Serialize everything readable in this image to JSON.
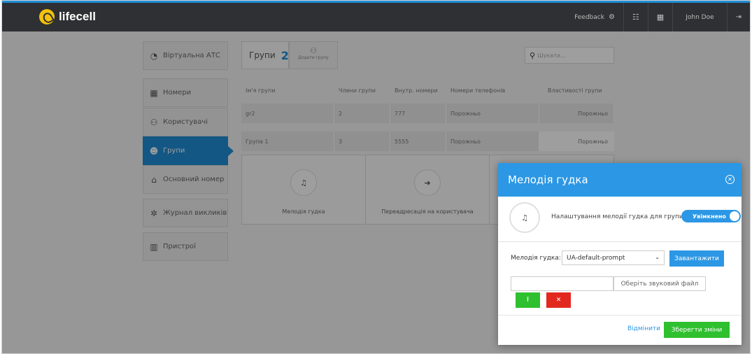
{
  "header": {
    "brand": "lifecell",
    "feedback_label": "Feedback",
    "user_name": "John Doe"
  },
  "sidebar": {
    "items": [
      {
        "label": "Віртуальна АТС",
        "icon": "gauge-icon"
      },
      {
        "label": "Номери",
        "icon": "grid-icon"
      },
      {
        "label": "Користувачі",
        "icon": "users-icon"
      },
      {
        "label": "Групи",
        "icon": "group-icon",
        "active": true
      },
      {
        "label": "Основний номер",
        "icon": "home-icon"
      },
      {
        "label": "Журнал викликів",
        "icon": "call-log-icon"
      },
      {
        "label": "Пристрої",
        "icon": "device-icon"
      }
    ]
  },
  "groups": {
    "title": "Групи",
    "count": "2",
    "add_label": "Додати групу",
    "search_placeholder": "Шукати..."
  },
  "table": {
    "columns": [
      "Ім'я групи",
      "Члени групи",
      "Внутр. номери",
      "Номери телефонів",
      "Властивості групи"
    ],
    "rows": [
      [
        "gr2",
        "2",
        "777",
        "Порожньо",
        "Порожньо"
      ],
      [
        "Група 1",
        "3",
        "5555",
        "Порожньо",
        "Порожньо"
      ]
    ]
  },
  "actions": [
    {
      "label": "Мелодія гудка",
      "icon": "music-note-icon"
    },
    {
      "label": "Переадресація на користувача",
      "icon": "arrow-right-icon"
    }
  ],
  "modal": {
    "title": "Мелодія гудка",
    "setting_label": "Налаштування мелодії гудка для групи",
    "toggle_label": "Увімкнено",
    "melody_label": "Мелодія гудка:",
    "melody_value": "UA-default-prompt",
    "upload_label": "Завантажити",
    "choose_file_label": "Оберіть звуковий файл",
    "cancel_label": "Відмінити",
    "save_label": "Зберегти зміни"
  },
  "colors": {
    "accent": "#2c97e4",
    "topbar": "#2f3033",
    "success": "#2fc02f",
    "danger": "#e3281f"
  }
}
